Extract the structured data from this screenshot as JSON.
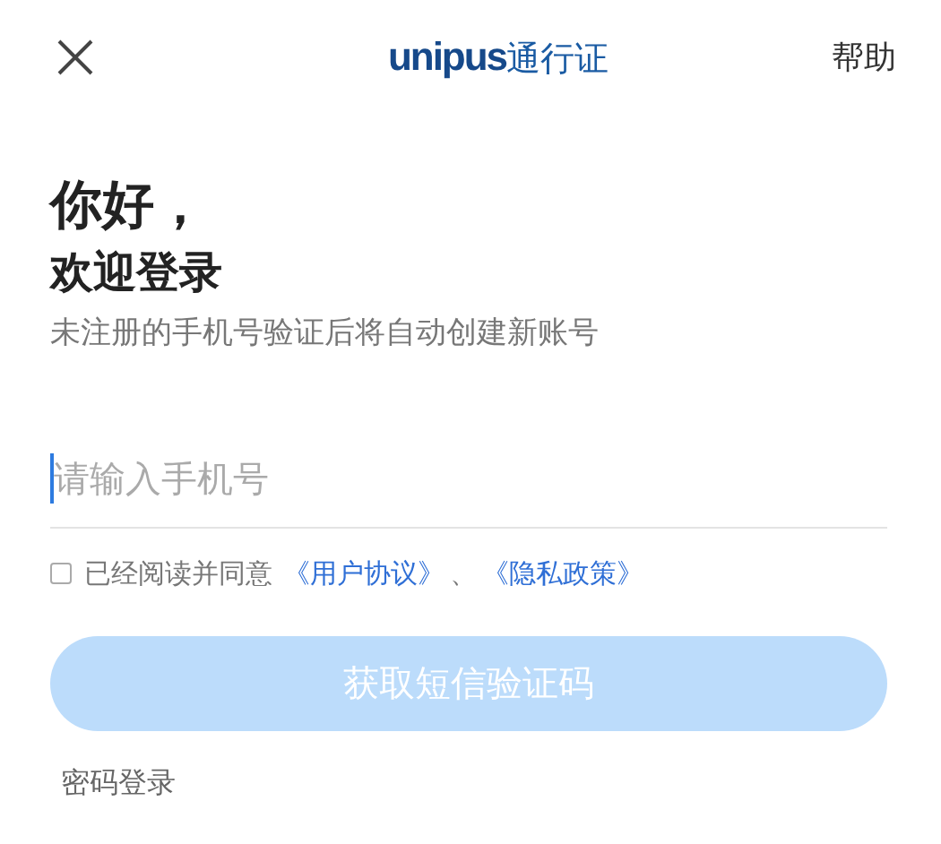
{
  "header": {
    "logo": {
      "brand": "unipus",
      "suffix": "通行证"
    },
    "help": "帮助"
  },
  "greeting": [
    "你好，",
    "欢迎登录"
  ],
  "subtitle": "未注册的手机号验证后将自动创建新账号",
  "phone": {
    "placeholder": "请输入手机号",
    "focused": true
  },
  "agreement": {
    "checked": false,
    "text": "已经阅读并同意",
    "links": [
      "《用户协议》",
      "《隐私政策》"
    ],
    "separator": "、"
  },
  "submit": {
    "label": "获取短信验证码",
    "disabled": true
  },
  "alt_login": "密码登录"
}
